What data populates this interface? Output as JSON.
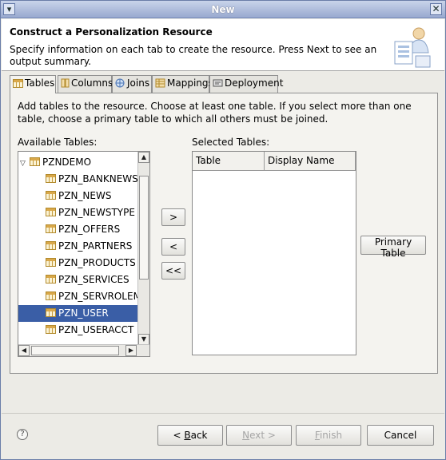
{
  "window": {
    "title": "New",
    "menu_glyph": "▾",
    "close_glyph": "✕"
  },
  "header": {
    "title": "Construct a Personalization Resource",
    "description": "Specify information on each tab to create the resource.  Press Next to see an output summary."
  },
  "tabs": [
    {
      "label": "Tables",
      "icon": "table-icon",
      "active": true
    },
    {
      "label": "Columns",
      "icon": "columns-icon",
      "active": false
    },
    {
      "label": "Joins",
      "icon": "joins-icon",
      "active": false
    },
    {
      "label": "Mappings",
      "icon": "mappings-icon",
      "active": false
    },
    {
      "label": "Deployment",
      "icon": "deployment-icon",
      "active": false
    }
  ],
  "panel": {
    "instructions": "Add tables to the resource.  Choose at least one table.  If you select more than one table, choose a primary table to which all others must be joined.",
    "available_label": "Available Tables:",
    "selected_label": "Selected Tables:",
    "tree": {
      "root": "PZNDEMO",
      "items": [
        "PZN_BANKNEWS",
        "PZN_NEWS",
        "PZN_NEWSTYPE",
        "PZN_OFFERS",
        "PZN_PARTNERS",
        "PZN_PRODUCTS",
        "PZN_SERVICES",
        "PZN_SERVROLEMAP",
        "PZN_USER",
        "PZN_USERACCT"
      ],
      "selected": "PZN_USER"
    },
    "buttons": {
      "add": ">",
      "remove": "<",
      "remove_all": "<<",
      "primary": "Primary Table"
    },
    "selected_table": {
      "columns": [
        "Table",
        "Display Name"
      ],
      "rows": []
    }
  },
  "footer": {
    "help_glyph": "?",
    "back_mnemonic": "B",
    "back_rest": "ack",
    "back_prefix": "< ",
    "next_mnemonic": "N",
    "next_rest": "ext >",
    "finish_mnemonic": "F",
    "finish_rest": "inish",
    "cancel": "Cancel"
  },
  "colors": {
    "selection": "#3a5ea6",
    "titlebar": "#98a9cf"
  }
}
